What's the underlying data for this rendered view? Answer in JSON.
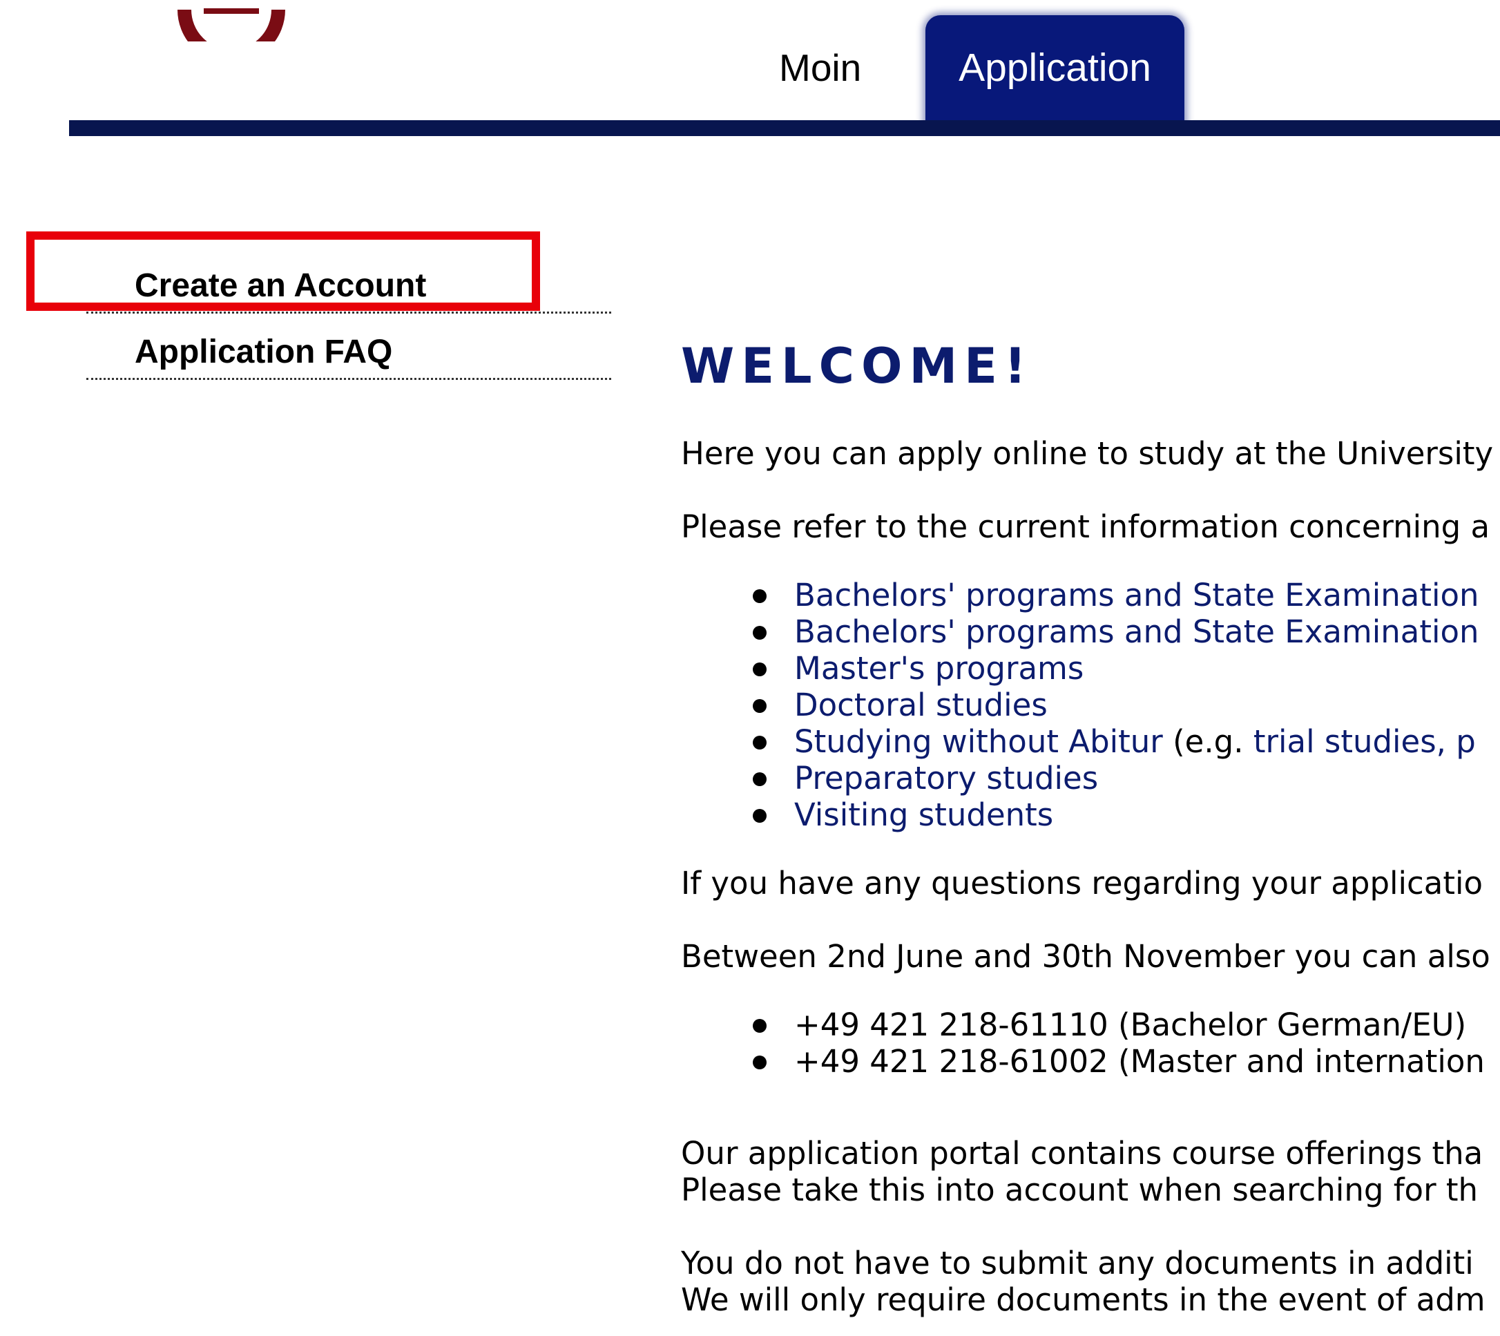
{
  "header": {
    "tabs": [
      {
        "label": "Moin"
      },
      {
        "label": "Application",
        "active": true
      }
    ],
    "colors": {
      "active_tab": "#08187a",
      "nav_bar": "#08154f"
    }
  },
  "sidebar": {
    "items": [
      {
        "label": "Create an Account",
        "highlighted": true
      },
      {
        "label": "Application FAQ"
      }
    ],
    "highlight_color": "#e8000a"
  },
  "main": {
    "title": "WELCOME!",
    "intro": "Here you can apply online to study at the University",
    "refer": "Please refer to the current information concerning a",
    "program_links": [
      {
        "label": "Bachelors' programs and State Examination"
      },
      {
        "label": "Bachelors' programs and State Examination"
      },
      {
        "label": "Master's programs"
      },
      {
        "label": "Doctoral studies"
      },
      {
        "label": "Studying without Abitur",
        "suffix": " (e.g. ",
        "extra_link": "trial studies, p"
      },
      {
        "label": "Preparatory studies"
      },
      {
        "label": "Visiting students"
      }
    ],
    "questions": "If you have any questions regarding your applicatio",
    "between": "Between 2nd June and 30th November you can also",
    "phones": [
      {
        "text": "+49 421 218-61110 (Bachelor German/EU)"
      },
      {
        "text": "+49 421 218-61002 (Master and internation"
      }
    ],
    "portal_line1": "Our application portal contains course offerings tha",
    "portal_line2": "Please take this into account when searching for th",
    "docs_line1": "You do not have to submit any documents in additi",
    "docs_line2": "We will only require documents in the event of adm",
    "colors": {
      "heading": "#0c1c6e",
      "link": "#0c1c6e"
    }
  }
}
